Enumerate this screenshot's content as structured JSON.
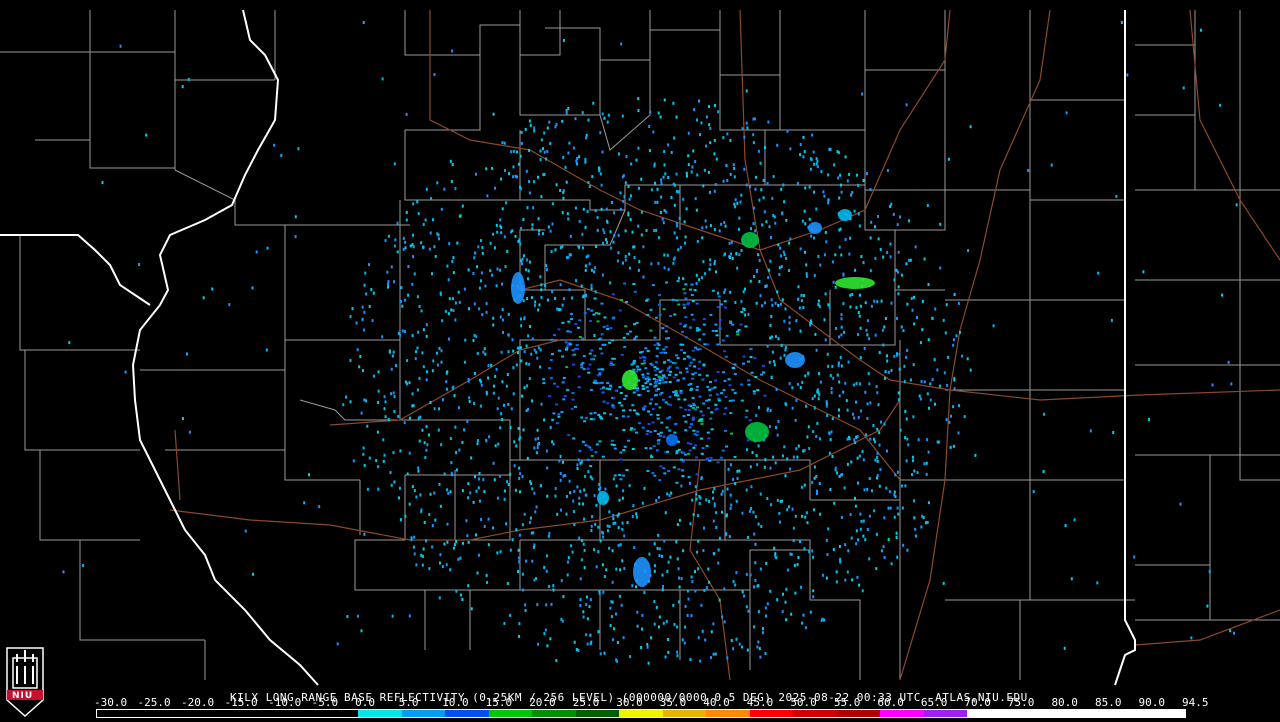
{
  "product": {
    "caption": "KILX LONG RANGE BASE REFLECTIVITY (0.25KM / 256 LEVEL) (000000/0000 0.5 DEG) 2025-08-22 00:33 UTC  ATLAS.NIU.EDU"
  },
  "logo": {
    "text": "NIU",
    "color": "#c8102e"
  },
  "colors": {
    "background": "#000000",
    "county_lines": "#9a9a9a",
    "state_lines": "#ffffff",
    "highways": "#8b4a2a"
  },
  "legend": {
    "ticks": [
      "-30.0",
      "-25.0",
      "-20.0",
      "-15.0",
      "-10.0",
      "-5.0",
      "0.0",
      "5.0",
      "10.0",
      "15.0",
      "20.0",
      "25.0",
      "30.0",
      "35.0",
      "40.0",
      "45.0",
      "50.0",
      "55.0",
      "60.0",
      "65.0",
      "70.0",
      "75.0",
      "80.0",
      "85.0",
      "90.0",
      "94.5"
    ],
    "colors": [
      "#000000",
      "#000000",
      "#000000",
      "#000000",
      "#000000",
      "#000000",
      "#00e6e6",
      "#009ef0",
      "#0050f0",
      "#00c800",
      "#009000",
      "#006000",
      "#f0f000",
      "#e6b400",
      "#ff8c00",
      "#ff0000",
      "#d00000",
      "#b00000",
      "#ff00ff",
      "#a020f0",
      "#ffffff",
      "#ffffff",
      "#ffffff",
      "#ffffff",
      "#ffffff"
    ]
  },
  "echoes": {
    "palette": [
      "#00d0e8",
      "#00b8f0",
      "#1e90ff",
      "#0070f0",
      "#2040e8",
      "#00c040",
      "#30e830"
    ]
  }
}
